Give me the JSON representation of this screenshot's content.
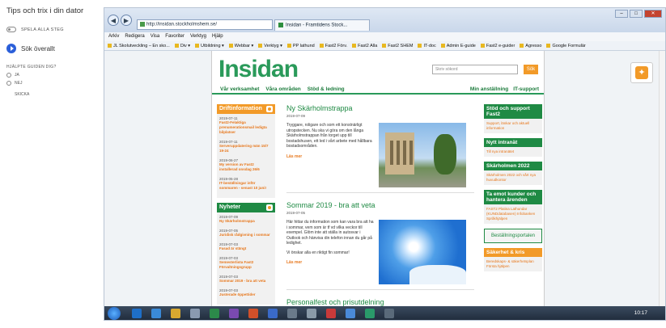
{
  "guide": {
    "title": "Tips och trix i din dator",
    "play_all": "SPELA ALLA STEG",
    "search_all": "Sök överallt",
    "helped": "HJÄLPTE GUIDEN DIG?",
    "yes": "JA",
    "no": "NEJ",
    "send": "SKICKA"
  },
  "browser": {
    "url": "http://insidan.stockholmshem.se/",
    "tab_title": "Insidan - Framtidens Stock...",
    "win_min": "–",
    "win_max": "□",
    "win_close": "✕",
    "menu": [
      "Arkiv",
      "Redigera",
      "Visa",
      "Favoriter",
      "Verktyg",
      "Hjälp"
    ],
    "favorites": [
      "JL Skolutveckling – En sko...",
      "Div ▾",
      "Utbildning ▾",
      "Webbar ▾",
      "Verktyg ▾",
      "PP lathund",
      "Fast2 Förv.",
      "Fast2 Alla",
      "Fast2 SHEM",
      "IT-doc",
      "Admin E-guide",
      "Fast2 e-guider",
      "Agresso",
      "Google Formulär"
    ]
  },
  "site": {
    "logo": "Insidan",
    "search_placeholder": "Skriv sökord",
    "search_button": "Sök",
    "nav_left": [
      "Vår verksamhet",
      "Våra områden",
      "Stöd & ledning"
    ],
    "nav_right": [
      "Min anställning",
      "IT-support"
    ],
    "driftinfo": {
      "title": "Driftinformation",
      "items": [
        {
          "date": "2019-07-11",
          "text": "Fast2-Felaktiga prenumerationsmail ledigta bilplatser"
        },
        {
          "date": "2019-07-11",
          "text": "Serveruppdatering män 15/7 19-24"
        },
        {
          "date": "2019-06-27",
          "text": "My version av Fast2 installerad onsdag 26/6"
        },
        {
          "date": "2019-05-28",
          "text": "IT-beställningar inför sommaren - senast 10 juni!"
        }
      ]
    },
    "nyheter": {
      "title": "Nyheter",
      "items": [
        {
          "date": "2019-07-09",
          "text": "Ny Skärholmstrappa"
        },
        {
          "date": "2019-07-05",
          "text": "Juridisk rådgivning i sommar"
        },
        {
          "date": "2019-07-03",
          "text": "Fasad är stängt"
        },
        {
          "date": "2019-07-03",
          "text": "Semesterlista Fast2 Förvaltningsgrupp"
        },
        {
          "date": "2019-07-03",
          "text": "Sommar 2019 - bra att veta"
        },
        {
          "date": "2019-07-03",
          "text": "Justerade öppettider"
        }
      ]
    },
    "articles": [
      {
        "title": "Ny Skärholmstrappa",
        "date": "2019-07-09",
        "text": "Tryggare, roligare och som ett konstnärligt utropstecken. Nu ska vi göra om den långa Skärholmstrappan från torget upp till bostadshusen, ett led i vårt arbete med hållbara bostadsområden.",
        "more": "Läs mer"
      },
      {
        "title": "Sommar 2019 - bra att veta",
        "date": "2019-07-05",
        "text": "Här hittar du information som kan vara bra att ha i sommar, vem som är tf vd vilka veckor till exempel. Glöm inte att ställa in autosvar i Outlook och hänvisa din telefon innan du går på ledighet.",
        "text2": "Vi önskar alla en riktigt fin sommar!",
        "more": "Läs mer"
      },
      {
        "title": "Personalfest och prisutdelning",
        "date": "2019-07-04"
      }
    ],
    "right_boxes": [
      {
        "title": "Stöd och support Fast2",
        "sub": "Support, länkar och aktuell information"
      },
      {
        "title": "Nytt intranät",
        "sub": "Till nya intranätet"
      },
      {
        "title": "Skärholmen 2022",
        "sub": "Skärholmen 2022 och vårt nya huvudkontor"
      },
      {
        "title": "Ta emot kunder och hantera ärenden",
        "sub": "FAST2 Platina Lathundar (KUNDdatabasen) Infobanken Språkhjälpen"
      }
    ],
    "bestall": "Beställningsportalen",
    "sakerhet": {
      "title": "Säkerhet & kris",
      "sub": "Beredskaps- & säkerhetsplan Första hjälpen"
    }
  },
  "taskbar": {
    "clock": "10:17"
  }
}
